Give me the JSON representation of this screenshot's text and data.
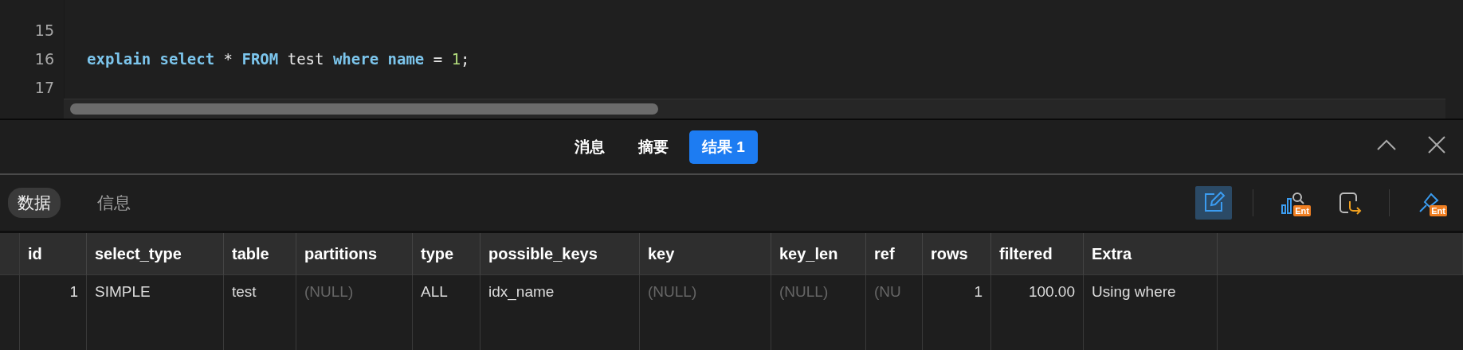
{
  "editor": {
    "lines": [
      {
        "number": "15"
      },
      {
        "number": "16",
        "tokens": [
          {
            "kind": "keyword",
            "text": "explain "
          },
          {
            "kind": "keyword",
            "text": "select "
          },
          {
            "kind": "plain",
            "text": "* "
          },
          {
            "kind": "keyword",
            "text": "FROM "
          },
          {
            "kind": "plain",
            "text": "test "
          },
          {
            "kind": "keyword",
            "text": "where "
          },
          {
            "kind": "keyword",
            "text": "name "
          },
          {
            "kind": "plain",
            "text": "= "
          },
          {
            "kind": "number",
            "text": "1"
          },
          {
            "kind": "plain",
            "text": ";"
          }
        ]
      },
      {
        "number": "17"
      }
    ]
  },
  "result_tabs": [
    {
      "label": "消息",
      "selected": false
    },
    {
      "label": "摘要",
      "selected": false
    },
    {
      "label": "结果 1",
      "selected": true
    }
  ],
  "view_tabs": [
    {
      "label": "数据",
      "selected": true
    },
    {
      "label": "信息",
      "selected": false
    }
  ],
  "toolbar": [
    {
      "kind": "edit",
      "active": true
    },
    {
      "kind": "divider"
    },
    {
      "kind": "chart",
      "badge": "Ent",
      "active": false
    },
    {
      "kind": "export",
      "active": false
    },
    {
      "kind": "divider"
    },
    {
      "kind": "pin",
      "badge": "Ent",
      "active": false
    }
  ],
  "table": {
    "columns": [
      {
        "label": "id",
        "kind": "numeric"
      },
      {
        "label": "select_type",
        "kind": "text"
      },
      {
        "label": "table",
        "kind": "text"
      },
      {
        "label": "partitions",
        "kind": "text"
      },
      {
        "label": "type",
        "kind": "text"
      },
      {
        "label": "possible_keys",
        "kind": "text"
      },
      {
        "label": "key",
        "kind": "text"
      },
      {
        "label": "key_len",
        "kind": "text"
      },
      {
        "label": "ref",
        "kind": "text"
      },
      {
        "label": "rows",
        "kind": "numeric"
      },
      {
        "label": "filtered",
        "kind": "numeric"
      },
      {
        "label": "Extra",
        "kind": "text"
      }
    ],
    "rows": [
      {
        "cells": [
          {
            "text": "1",
            "null": false
          },
          {
            "text": "SIMPLE",
            "null": false
          },
          {
            "text": "test",
            "null": false
          },
          {
            "text": "(NULL)",
            "null": true
          },
          {
            "text": "ALL",
            "null": false
          },
          {
            "text": "idx_name",
            "null": false
          },
          {
            "text": "(NULL)",
            "null": true
          },
          {
            "text": "(NULL)",
            "null": true
          },
          {
            "text": "(NU",
            "null": true
          },
          {
            "text": "1",
            "null": false
          },
          {
            "text": "100.00",
            "null": false
          },
          {
            "text": "Using where",
            "null": false
          }
        ]
      }
    ]
  }
}
